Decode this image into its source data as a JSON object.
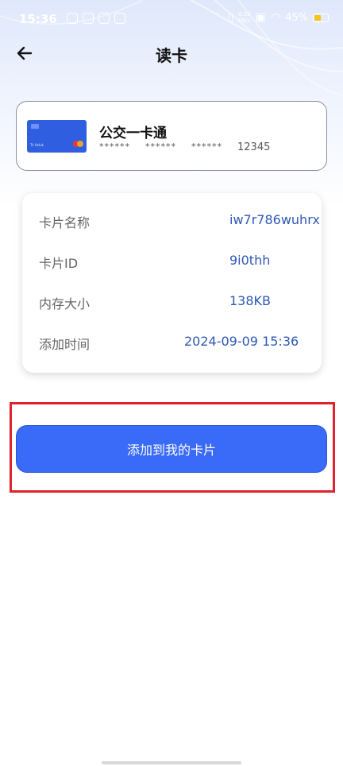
{
  "status_bar": {
    "time": "15:36",
    "net_speed_top": "0.02",
    "net_speed_bottom": "KB/s",
    "battery_percent": "45%"
  },
  "header": {
    "title": "读卡",
    "back_icon": "arrow-left-icon"
  },
  "card": {
    "name": "公交一卡通",
    "masked_groups": [
      "******",
      "******",
      "******"
    ],
    "last_digits": "12345",
    "thumb_text": "Tri Aeluk",
    "thumb_color": "#2f5fe0"
  },
  "details": [
    {
      "label": "卡片名称",
      "value": "iw7r786wuhrx"
    },
    {
      "label": "卡片ID",
      "value": "9i0thh"
    },
    {
      "label": "内存大小",
      "value": "138KB"
    },
    {
      "label": "添加时间",
      "value": "2024-09-09 15:36"
    }
  ],
  "actions": {
    "add_button_label": "添加到我的卡片"
  },
  "colors": {
    "primary": "#3a6af8",
    "value_text": "#2e58b5",
    "highlight": "#e0222e"
  }
}
